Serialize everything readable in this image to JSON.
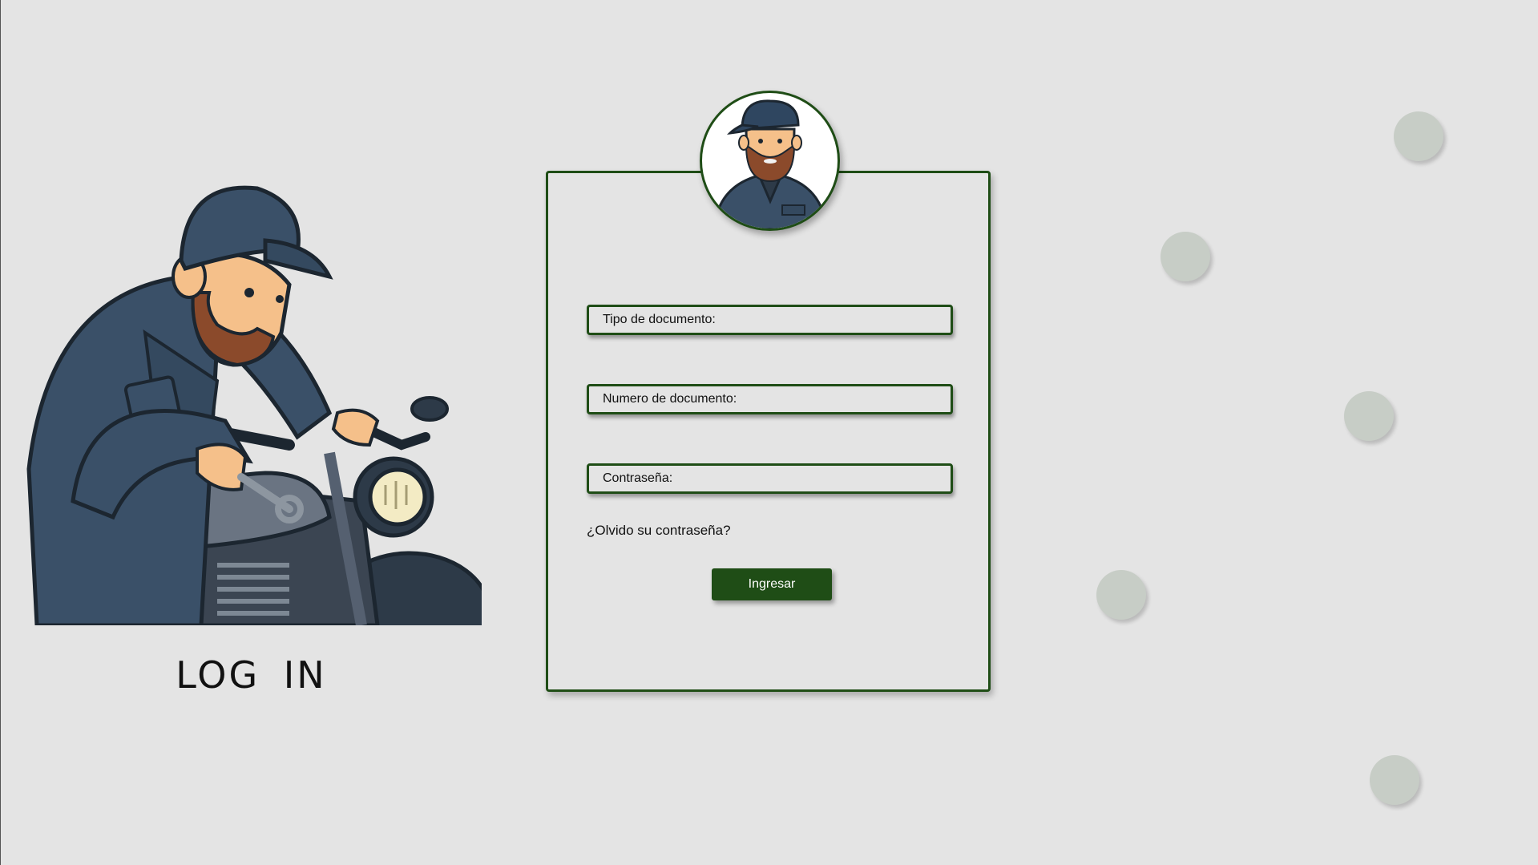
{
  "page": {
    "title": "LOG IN"
  },
  "form": {
    "fields": [
      {
        "placeholder": "Tipo de documento:",
        "value": ""
      },
      {
        "placeholder": "Numero de documento:",
        "value": ""
      },
      {
        "placeholder": "Contraseña:",
        "value": ""
      }
    ],
    "forgot_link": "¿Olvido su contraseña?",
    "submit_label": "Ingresar"
  },
  "images": {
    "illustration": "mechanic-with-motorcycle",
    "avatar": "mechanic-avatar"
  },
  "colors": {
    "accent": "#1f4d16",
    "background": "#e4e4e4",
    "dot": "#c7cdc6",
    "uniform": "#3a5068"
  }
}
